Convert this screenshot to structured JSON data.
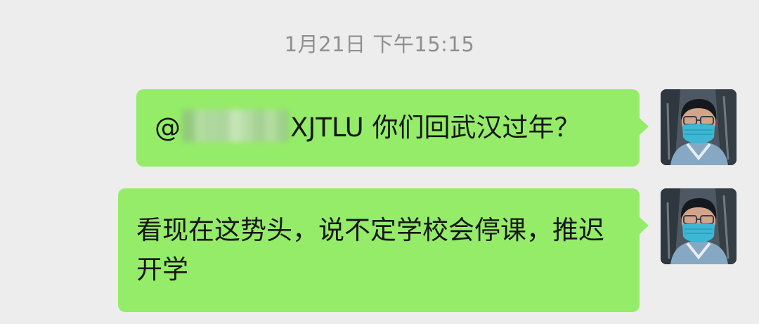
{
  "timestamp": "1月21日 下午15:15",
  "messages": [
    {
      "mention_at": "@",
      "mention_suffix": "XJTLU",
      "text": "你们回武汉过年？"
    },
    {
      "text": "看现在这势头，说不定学校会停课，推迟开学"
    }
  ],
  "colors": {
    "background": "#ededed",
    "bubble": "#95ec69",
    "timestamp": "#8f8f8f"
  },
  "icons": {
    "avatar": "user-avatar-masked-person"
  }
}
